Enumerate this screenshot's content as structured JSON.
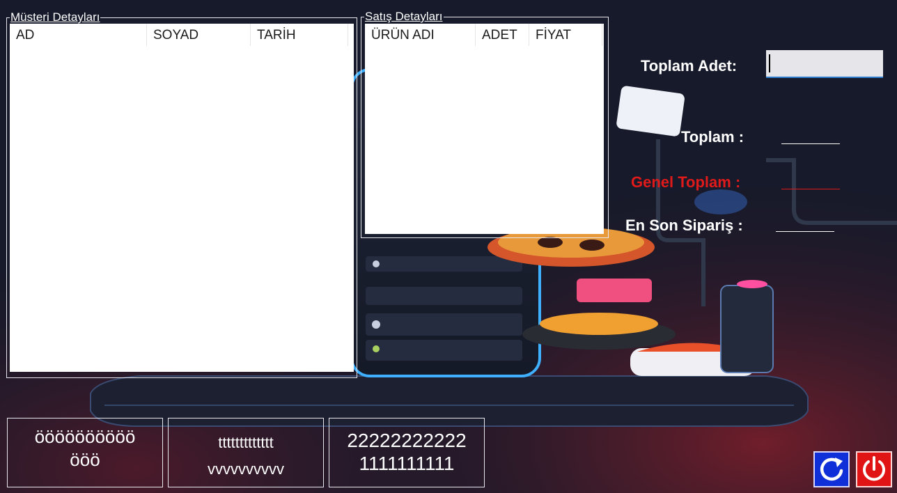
{
  "customer_group": {
    "title": "Müsteri Detayları",
    "columns": [
      "AD",
      "SOYAD",
      "TARİH"
    ]
  },
  "sales_group": {
    "title": "Satış Detayları",
    "columns": [
      "ÜRÜN ADI",
      "ADET",
      "FİYAT"
    ]
  },
  "summary": {
    "toplam_adet_label": "Toplam Adet:",
    "toplam_adet_value": "",
    "toplam_label": "Toplam :",
    "genel_toplam_label": "Genel Toplam :",
    "en_son_siparis_label": "En Son Sipariş :"
  },
  "bottom_boxes": [
    {
      "line1": "öööööööööö",
      "line2": "ööö"
    },
    {
      "line1": "ttttttttttttt",
      "line2": "vvvvvvvvvv"
    },
    {
      "line1": "22222222222",
      "line2": "1111111111"
    }
  ],
  "buttons": {
    "refresh_icon": "refresh-icon",
    "power_icon": "power-icon"
  },
  "colors": {
    "accent_red": "#e01a1a",
    "refresh_blue": "#0f2fd8",
    "power_red": "#e01414"
  }
}
